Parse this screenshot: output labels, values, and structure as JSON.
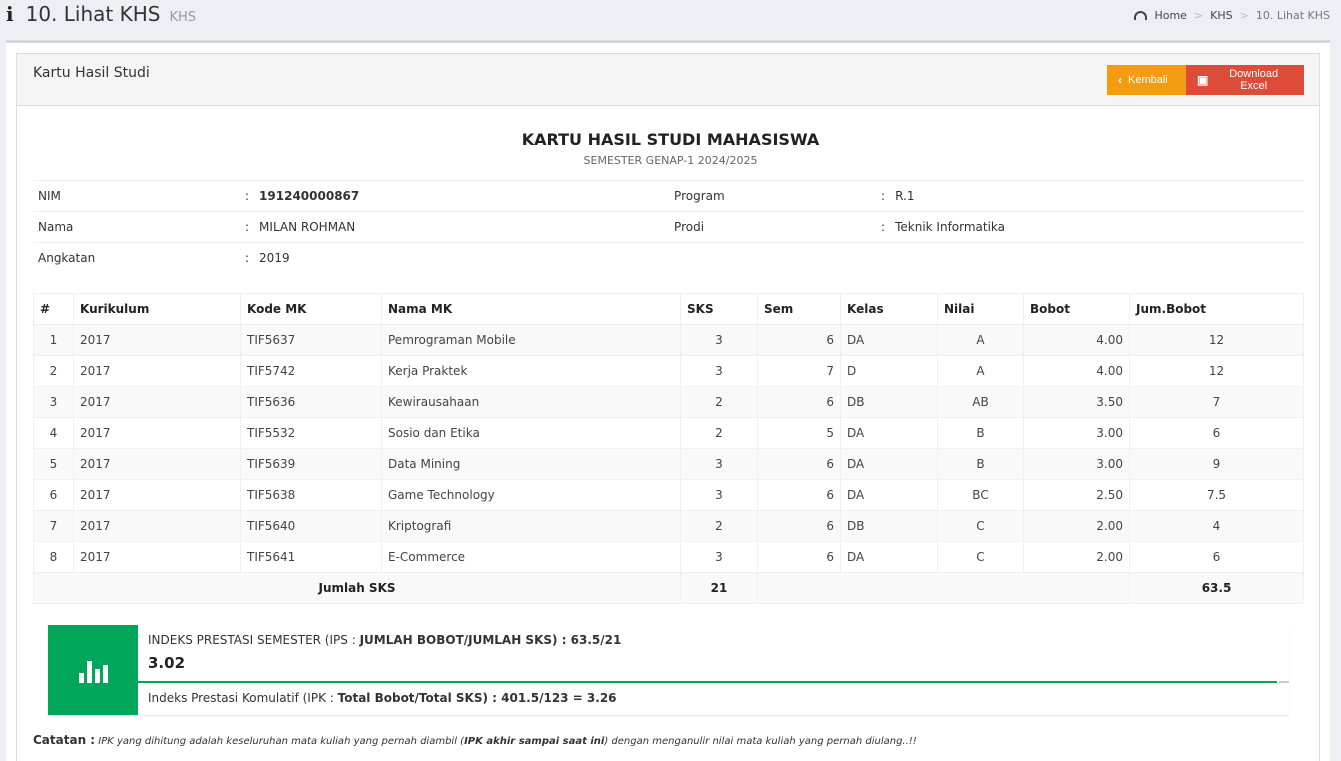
{
  "header": {
    "title": "10. Lihat KHS",
    "subtitle": "KHS",
    "breadcrumb": [
      "Home",
      "KHS",
      "10. Lihat KHS"
    ]
  },
  "box": {
    "title": "Kartu Hasil Studi",
    "back_label": "Kembali",
    "excel_label": "Download Excel"
  },
  "doc": {
    "title": "KARTU HASIL STUDI MAHASISWA",
    "semester": "SEMESTER GENAP-1 2024/2025"
  },
  "student": {
    "nim_label": "NIM",
    "nim": "191240000867",
    "nama_label": "Nama",
    "nama": "MILAN ROHMAN",
    "angkatan_label": "Angkatan",
    "angkatan": "2019",
    "program_label": "Program",
    "program": "R.1",
    "prodi_label": "Prodi",
    "prodi": "Teknik Informatika",
    "colon": ":"
  },
  "table": {
    "headers": [
      "#",
      "Kurikulum",
      "Kode MK",
      "Nama MK",
      "SKS",
      "Sem",
      "Kelas",
      "Nilai",
      "Bobot",
      "Jum.Bobot"
    ],
    "rows": [
      [
        "1",
        "2017",
        "TIF5637",
        "Pemrograman Mobile",
        "3",
        "6",
        "DA",
        "A",
        "4.00",
        "12"
      ],
      [
        "2",
        "2017",
        "TIF5742",
        "Kerja Praktek",
        "3",
        "7",
        "D",
        "A",
        "4.00",
        "12"
      ],
      [
        "3",
        "2017",
        "TIF5636",
        "Kewirausahaan",
        "2",
        "6",
        "DB",
        "AB",
        "3.50",
        "7"
      ],
      [
        "4",
        "2017",
        "TIF5532",
        "Sosio dan Etika",
        "2",
        "5",
        "DA",
        "B",
        "3.00",
        "6"
      ],
      [
        "5",
        "2017",
        "TIF5639",
        "Data Mining",
        "3",
        "6",
        "DA",
        "B",
        "3.00",
        "9"
      ],
      [
        "6",
        "2017",
        "TIF5638",
        "Game Technology",
        "3",
        "6",
        "DA",
        "BC",
        "2.50",
        "7.5"
      ],
      [
        "7",
        "2017",
        "TIF5640",
        "Kriptografi",
        "2",
        "6",
        "DB",
        "C",
        "2.00",
        "4"
      ],
      [
        "8",
        "2017",
        "TIF5641",
        "E-Commerce",
        "3",
        "6",
        "DA",
        "C",
        "2.00",
        "6"
      ]
    ],
    "footer_label": "Jumlah SKS",
    "total_sks": "21",
    "total_bobot": "63.5"
  },
  "ip": {
    "ips_prefix": "INDEKS PRESTASI SEMESTER (IPS : ",
    "ips_formula": "JUMLAH BOBOT/JUMLAH SKS",
    "ips_suffix": ") : 63.5/21",
    "ips_value": "3.02",
    "ipk_prefix": "Indeks Prestasi Komulatif (IPK : ",
    "ipk_formula": "Total Bobot/Total SKS",
    "ipk_suffix": ") : 401.5/123 = 3.26",
    "progress_percent": 99
  },
  "note": {
    "label": "Catatan :",
    "text_a": "IPK yang dihitung adalah keseluruhan mata kuliah yang pernah diambil (",
    "text_b": "IPK akhir sampai saat ini",
    "text_c": ") dengan menganulir nilai mata kuliah yang pernah diulang..!!"
  },
  "colors": {
    "warning": "#f39c12",
    "danger": "#dd4b39",
    "success": "#00a65a"
  }
}
